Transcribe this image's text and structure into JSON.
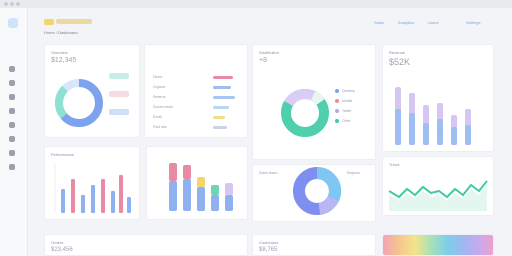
{
  "header": {
    "breadcrumb": "Home / Dashboard",
    "nav_items": [
      "Sales",
      "Analytics",
      "Users",
      "Settings"
    ]
  },
  "sidebar": {
    "icons": [
      "home-icon",
      "chart-icon",
      "user-icon",
      "folder-icon",
      "calendar-icon",
      "mail-icon",
      "settings-icon",
      "logout-icon"
    ]
  },
  "cards": {
    "overview": {
      "title": "Overview",
      "value": "$12,345"
    },
    "channels": {
      "title": "",
      "items": [
        "Direct",
        "Organic",
        "Referral",
        "Social media",
        "Email",
        "Paid ads"
      ]
    },
    "distribution": {
      "title": "Distribution",
      "value": "+8",
      "legend": [
        "Desktop",
        "Mobile",
        "Tablet",
        "Other"
      ]
    },
    "revenue": {
      "title": "Revenue",
      "value": "$52K"
    },
    "bars": {
      "title": "Performance"
    },
    "stacked": {
      "title": ""
    },
    "pie": {
      "label_left": "Sales share",
      "label_right": "Regions"
    },
    "trend": {
      "title": "Trend"
    },
    "bottom_a": {
      "title": "Orders",
      "value": "$23,456"
    },
    "bottom_b": {
      "title": "Customers",
      "value": "$8,765"
    }
  },
  "colors": {
    "accent": "#6e8ee8",
    "teal": "#43c9a6",
    "pink": "#e98aa4",
    "purple": "#b8a4e8",
    "yellow": "#f3d56b"
  }
}
